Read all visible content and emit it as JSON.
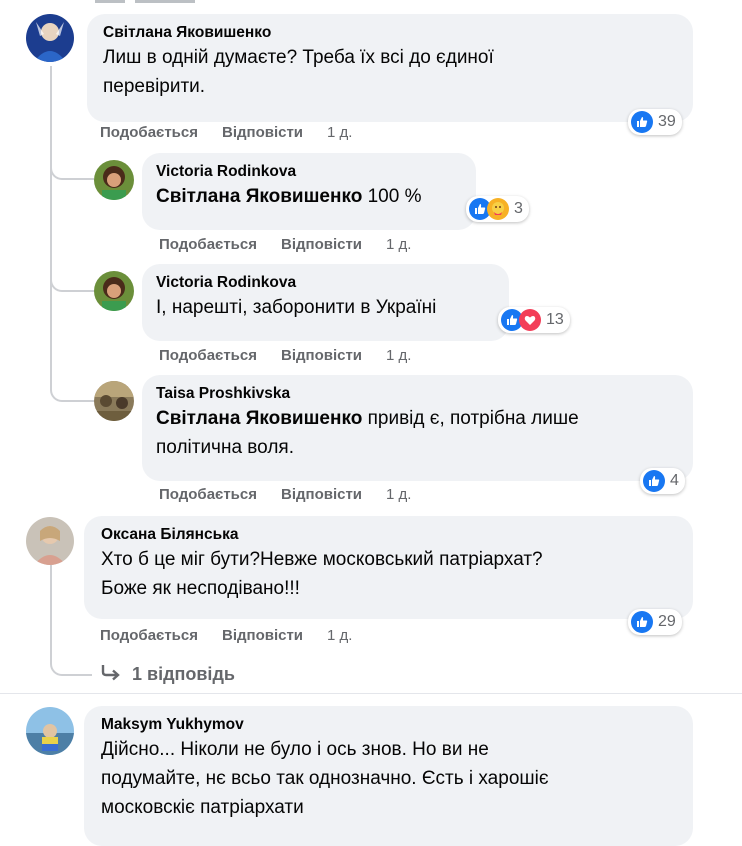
{
  "comments": [
    {
      "author": "Світлана Яковишенко",
      "text_line1": "Лиш в одній думаєте? Треба їх всі до єдиної",
      "text_line2": "перевірити.",
      "like": "Подобається",
      "reply": "Відповісти",
      "time": "1 д.",
      "reactions": {
        "count": "39",
        "types": [
          "like"
        ]
      }
    },
    {
      "author": "Victoria Rodinkova",
      "mention": "Світлана Яковишенко",
      "text": " 100 %",
      "like": "Подобається",
      "reply": "Відповісти",
      "time": "1 д.",
      "reactions": {
        "count": "3",
        "types": [
          "like",
          "care"
        ]
      }
    },
    {
      "author": "Victoria Rodinkova",
      "text": "І, нарешті, заборонити в Україні",
      "like": "Подобається",
      "reply": "Відповісти",
      "time": "1 д.",
      "reactions": {
        "count": "13",
        "types": [
          "like",
          "love"
        ]
      }
    },
    {
      "author": "Taisa Proshkivska",
      "mention": "Світлана Яковишенко",
      "text_line1": " привід є, потрібна лише",
      "text_line2": "політична воля.",
      "like": "Подобається",
      "reply": "Відповісти",
      "time": "1 д.",
      "reactions": {
        "count": "4",
        "types": [
          "like"
        ]
      }
    },
    {
      "author": "Оксана Білянська",
      "text_line1": "Хто б це міг бути?Невже московський патріархат?",
      "text_line2": "Боже як несподівано!!!",
      "like": "Подобається",
      "reply": "Відповісти",
      "time": "1 д.",
      "reactions": {
        "count": "29",
        "types": [
          "like"
        ]
      },
      "more_replies": "1 відповідь"
    },
    {
      "author": "Maksym Yukhymov",
      "text_line1": "Дійсно... Ніколи не було і ось знов. Но ви не",
      "text_line2": "подумайте, нє всьо так однозначно. Єсть і харошіє",
      "text_line3": "московскіє патріархати"
    }
  ],
  "colors": {
    "bubble": "#f0f2f5",
    "like": "#1877f2",
    "love": "#f33e58",
    "meta": "#65676b",
    "thread": "#ced0d4"
  }
}
